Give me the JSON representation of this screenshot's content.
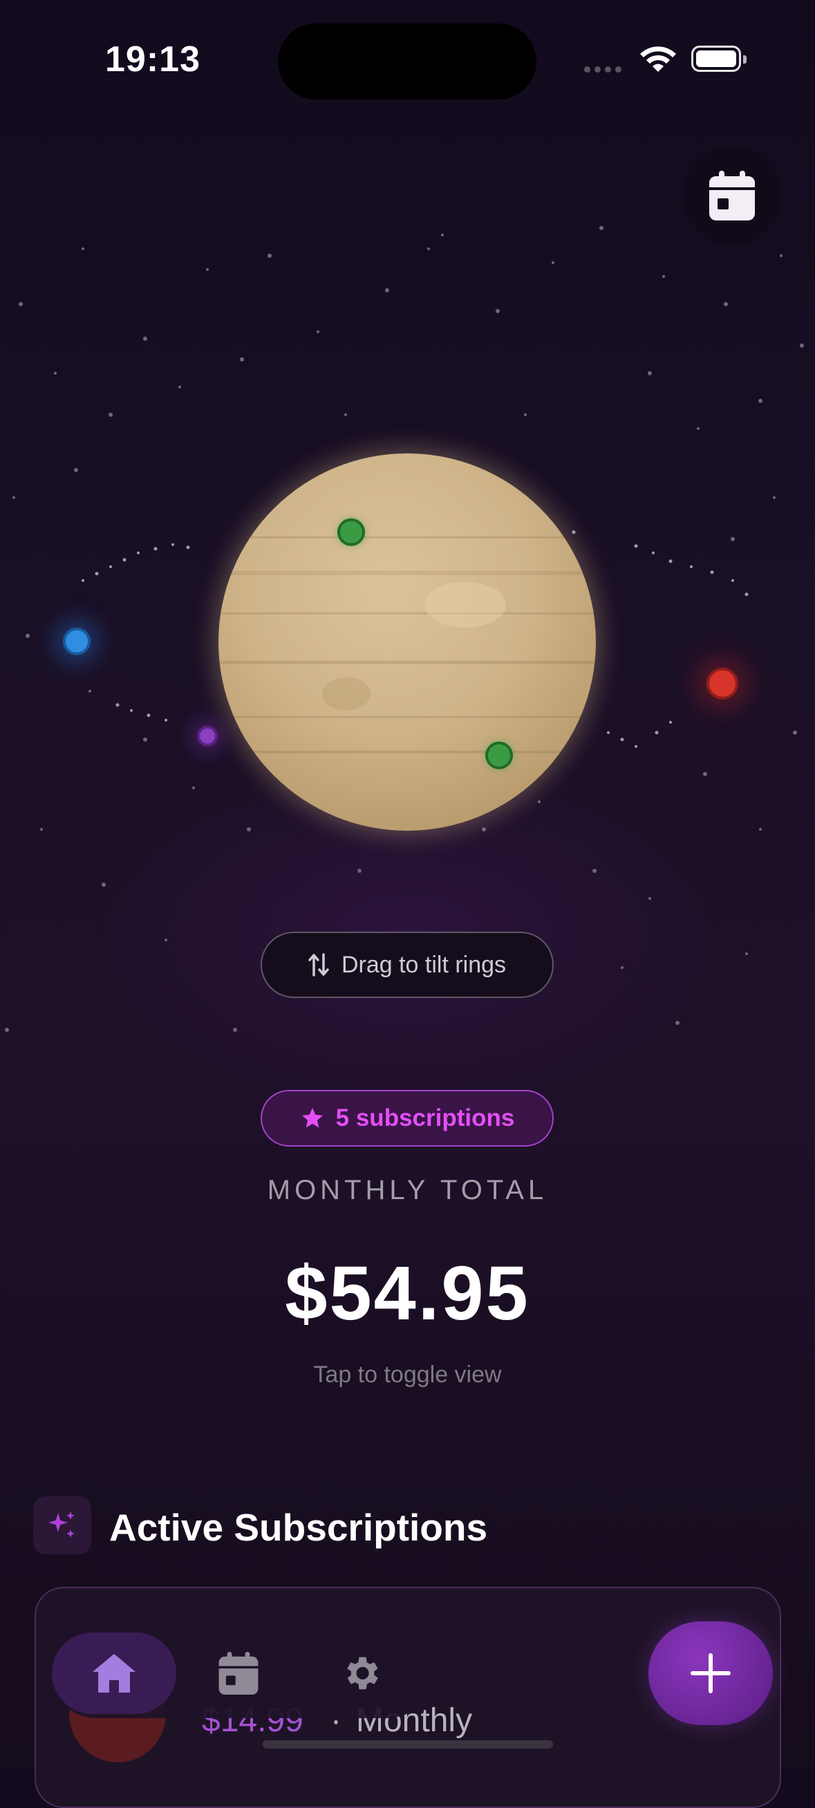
{
  "status_bar": {
    "time": "19:13"
  },
  "scene": {
    "hint": "Drag to tilt rings"
  },
  "summary": {
    "badge": "5 subscriptions",
    "label": "MONTHLY TOTAL",
    "amount": "$54.95",
    "toggle_hint": "Tap to toggle view"
  },
  "section": {
    "title": "Active Subscriptions"
  },
  "card": {
    "price": "$14.99",
    "separator": "·",
    "frequency": "Monthly"
  },
  "nav": {
    "items": [
      "home-icon",
      "calendar-icon",
      "gear-icon"
    ],
    "active": "home"
  },
  "colors": {
    "accent": "#a640c9",
    "badge_text": "#e34ff5",
    "fab": "#7a2cab"
  }
}
